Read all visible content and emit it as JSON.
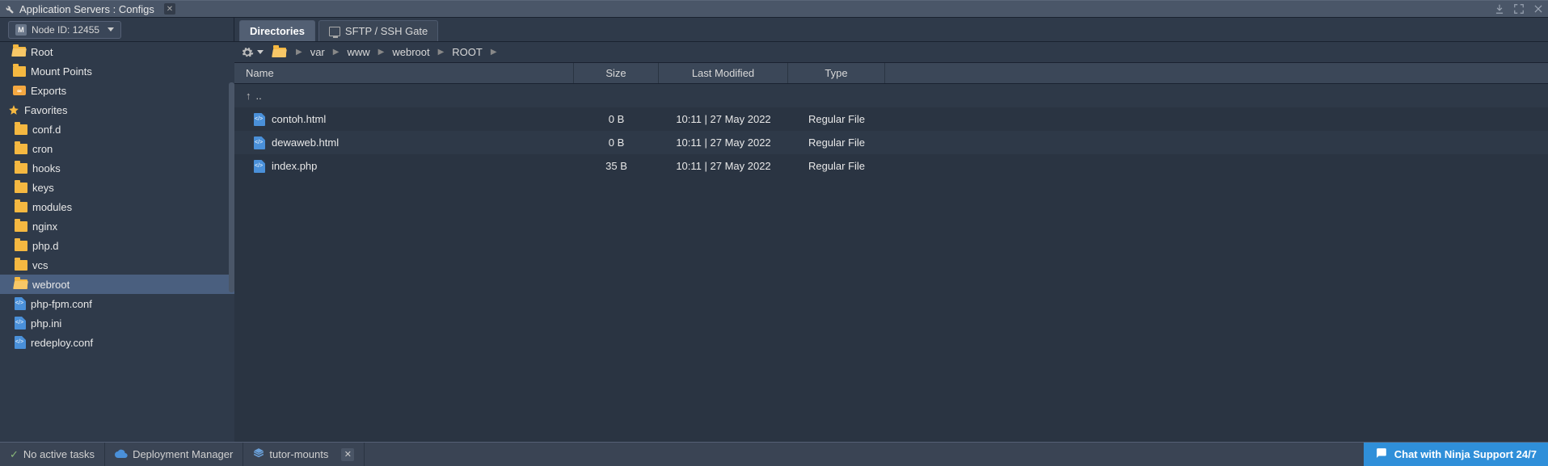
{
  "titlebar": {
    "title": "Application Servers : Configs"
  },
  "node_selector": {
    "label": "Node ID: 12455"
  },
  "tabs": {
    "directories": "Directories",
    "sftp": "SFTP / SSH Gate"
  },
  "sidebar": {
    "root": "Root",
    "mount": "Mount Points",
    "exports": "Exports",
    "favorites": "Favorites",
    "items": {
      "confd": "conf.d",
      "cron": "cron",
      "hooks": "hooks",
      "keys": "keys",
      "modules": "modules",
      "nginx": "nginx",
      "phpd": "php.d",
      "vcs": "vcs",
      "webroot": "webroot",
      "phpfpm": "php-fpm.conf",
      "phpini": "php.ini",
      "redeploy": "redeploy.conf"
    }
  },
  "breadcrumb": {
    "p0": "var",
    "p1": "www",
    "p2": "webroot",
    "p3": "ROOT"
  },
  "columns": {
    "name": "Name",
    "size": "Size",
    "modified": "Last Modified",
    "type": "Type"
  },
  "updir": {
    "icon": "↑",
    "label": ".."
  },
  "files": {
    "f0": {
      "name": "contoh.html",
      "size": "0 B",
      "modified": "10:11 | 27 May 2022",
      "type": "Regular File"
    },
    "f1": {
      "name": "dewaweb.html",
      "size": "0 B",
      "modified": "10:11 | 27 May 2022",
      "type": "Regular File"
    },
    "f2": {
      "name": "index.php",
      "size": "35 B",
      "modified": "10:11 | 27 May 2022",
      "type": "Regular File"
    }
  },
  "bottombar": {
    "tasks": "No active tasks",
    "deploy": "Deployment Manager",
    "tab": "tutor-mounts",
    "chat": "Chat with Ninja Support 24/7"
  }
}
